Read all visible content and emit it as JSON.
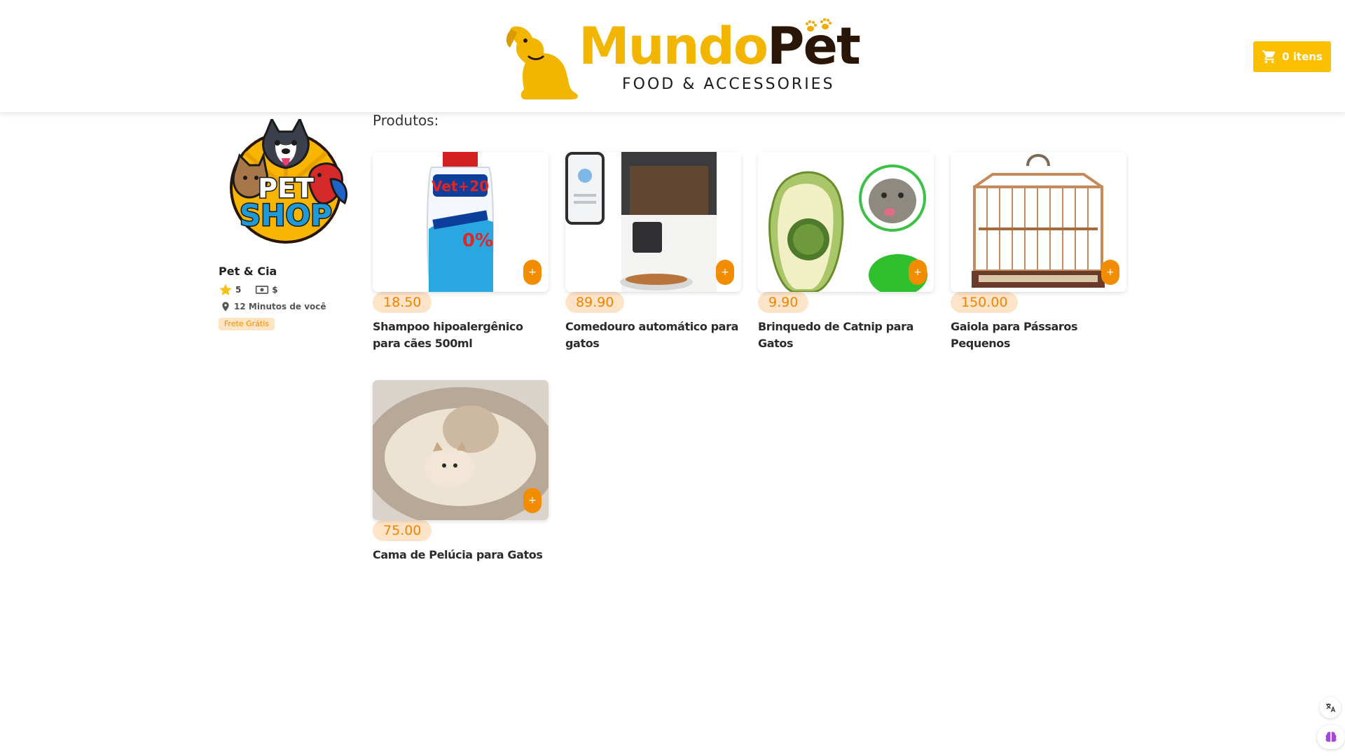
{
  "header": {
    "brand_primary": "Mundo",
    "brand_secondary": "Pet",
    "brand_tagline": "FOOD & ACCESSORIES",
    "cart_label": "0 itens"
  },
  "store": {
    "logo_top": "PET",
    "logo_bottom": "SHOP",
    "name": "Pet & Cia",
    "rating": "5",
    "price_level": "$",
    "distance": "12 Minutos de você",
    "badge": "Frete Grátis"
  },
  "main": {
    "section_title": "Produtos:",
    "products": [
      {
        "price": "18.50",
        "name": "Shampoo hipoalergênico para cães 500ml",
        "add_label": "+",
        "image": "shampoo-bottle"
      },
      {
        "price": "89.90",
        "name": "Comedouro automático para gatos",
        "add_label": "+",
        "image": "automatic-feeder"
      },
      {
        "price": "9.90",
        "name": "Brinquedo de Catnip para Gatos",
        "add_label": "+",
        "image": "catnip-toy"
      },
      {
        "price": "150.00",
        "name": "Gaiola para Pássaros Pequenos",
        "add_label": "+",
        "image": "bird-cage"
      },
      {
        "price": "75.00",
        "name": "Cama de Pelúcia para Gatos",
        "add_label": "+",
        "image": "plush-cat-bed"
      }
    ]
  },
  "colors": {
    "brand_yellow": "#fcc000",
    "accent_orange": "#f28c00",
    "price_bg": "#fde4c8"
  }
}
